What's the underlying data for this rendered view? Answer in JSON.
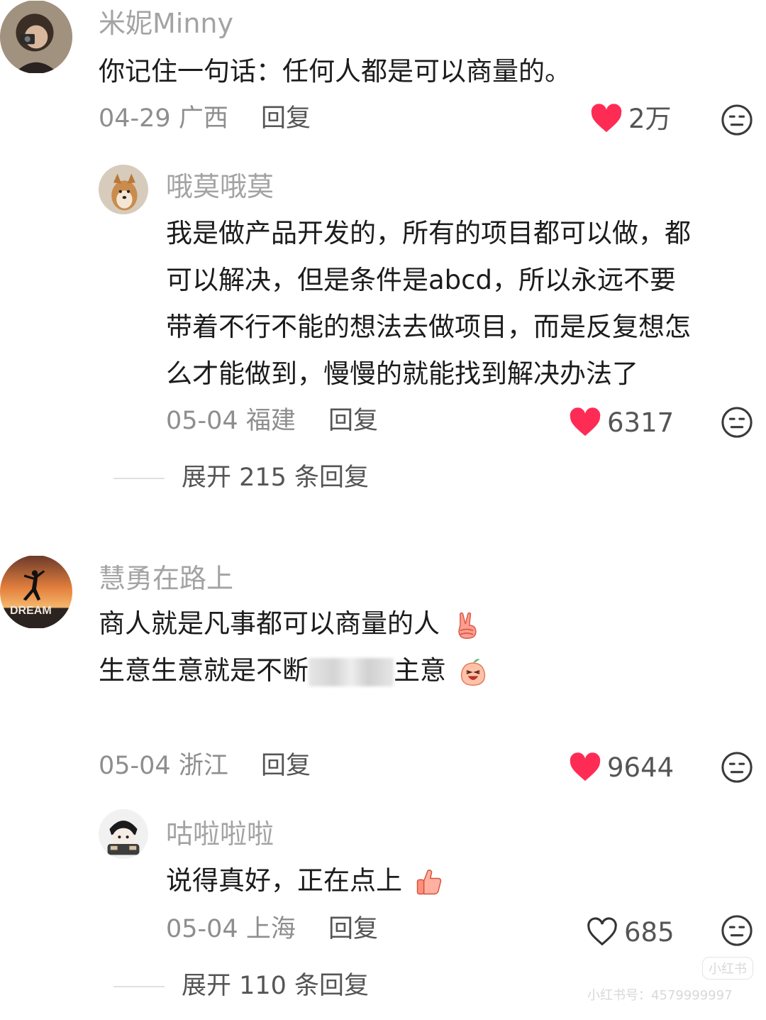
{
  "comments": [
    {
      "username": "米妮Minny",
      "lines": [
        "你记住一句话：任何人都是可以商量的。"
      ],
      "date": "04-29",
      "location": "广西",
      "reply_label": "回复",
      "likes": "2万",
      "liked": true,
      "replies": [
        {
          "username": "哦莫哦莫",
          "lines": [
            "我是做产品开发的，所有的项目都可以做，都",
            "可以解决，但是条件是abcd，所以永远不要",
            "带着不行不能的想法去做项目，而是反复想怎",
            "么才能做到，慢慢的就能找到解决办法了"
          ],
          "date": "05-04",
          "location": "福建",
          "reply_label": "回复",
          "likes": "6317",
          "liked": true
        }
      ],
      "expand_label": "展开 215 条回复"
    },
    {
      "username": "慧勇在路上",
      "avatar_text": "DREAM",
      "lines": [
        "商人就是凡事都可以商量的人",
        "生意生意就是不断",
        "主意"
      ],
      "date": "05-04",
      "location": "浙江",
      "reply_label": "回复",
      "likes": "9644",
      "liked": true,
      "replies": [
        {
          "username": "咕啦啦啦",
          "lines": [
            "说得真好，正在点上"
          ],
          "date": "05-04",
          "location": "上海",
          "reply_label": "回复",
          "likes": "685",
          "liked": false
        }
      ],
      "expand_label": "展开 110 条回复"
    }
  ],
  "icons": {
    "heart_filled": "heart-filled-icon",
    "heart_outline": "heart-outline-icon",
    "dislike": "neutral-face-icon",
    "victory_emoji": "victory-hand-emoji",
    "laugh_emoji": "laughing-peach-emoji",
    "thumbs_up_emoji": "thumbs-up-emoji"
  },
  "colors": {
    "like_red": "#fe2c55",
    "username_gray": "#a3a3a3",
    "meta_gray": "#8e8e8e"
  },
  "watermark": {
    "line1": "小红书",
    "line2": "小红书号：4579999997"
  }
}
